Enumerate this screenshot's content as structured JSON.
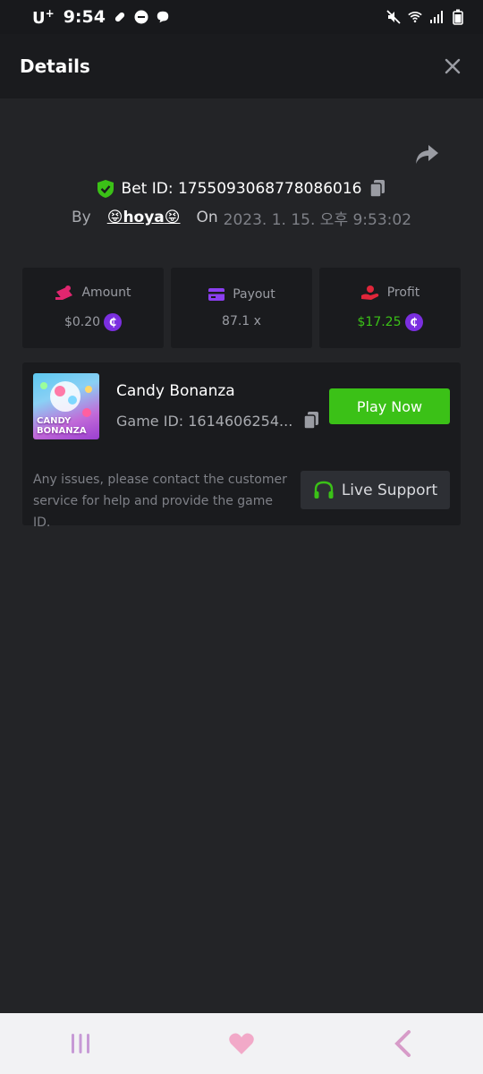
{
  "status_bar": {
    "carrier": "U",
    "carrier_sup": "+",
    "time": "9:54"
  },
  "header": {
    "title": "Details"
  },
  "bet": {
    "id_label": "Bet ID: 1755093068778086016",
    "by_label": "By",
    "user_prefix_emoji": "😝",
    "username": "hoya",
    "user_suffix_emoji": "😝",
    "on_label": "On",
    "date": "2023. 1. 15. 오후 9:53:02"
  },
  "stats": [
    {
      "title": "Amount",
      "value": "$0.20",
      "coin": true,
      "icon": "amount-icon"
    },
    {
      "title": "Payout",
      "value": "87.1 x",
      "coin": false,
      "icon": "payout-card-icon"
    },
    {
      "title": "Profit",
      "value": "$17.25",
      "coin": true,
      "icon": "profit-hand-icon"
    }
  ],
  "coin_symbol": "₵",
  "game": {
    "thumb_line1": "CANDY",
    "thumb_line2": "BONANZA",
    "name": "Candy Bonanza",
    "id_label": "Game ID: 1614606254...",
    "play_label": "Play Now",
    "support_text": "Any issues, please contact the customer service for help and provide the game ID.",
    "support_label": "Live Support"
  },
  "colors": {
    "accent_green": "#3bc117",
    "coin_purple": "#7b2fe0",
    "background": "#232427",
    "card": "#1a1b1e"
  }
}
